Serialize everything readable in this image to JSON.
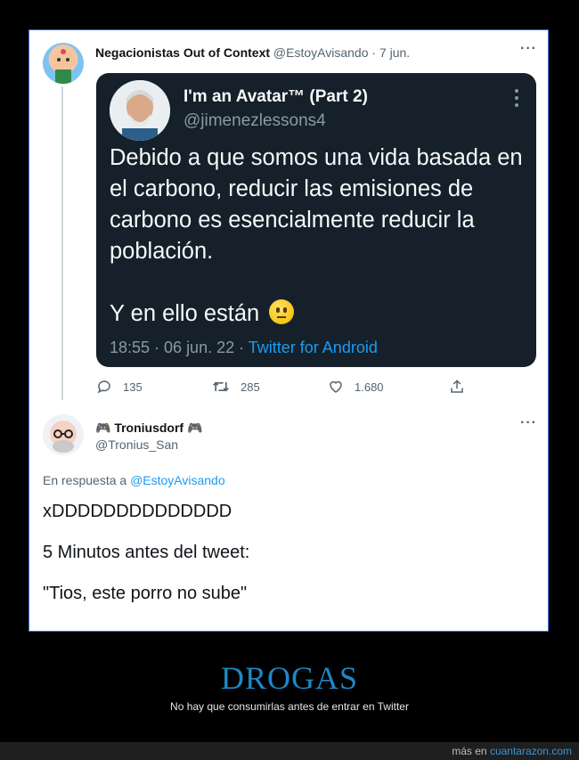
{
  "tweet1": {
    "display_name": "Negacionistas Out of Context",
    "handle": "@EstoyAvisando",
    "separator": "·",
    "date": "7 jun.",
    "more_icon": "more-icon"
  },
  "quoted": {
    "display_name": "I'm an Avatar™ (Part 2)",
    "handle": "@jimenezlessons4",
    "body_para1": "Debido a que somos una vida basada en el carbono, reducir las emisiones de carbono es esencialmente reducir la población.",
    "body_para2": "Y en ello están",
    "emoji": "neutral-face-emoji",
    "time": "18:55 · 06 jun. 22 · ",
    "source": "Twitter for Android"
  },
  "actions": {
    "replies": "135",
    "retweets": "285",
    "likes": "1.680"
  },
  "tweet2": {
    "display_name": "🎮 Troniusdorf 🎮",
    "handle": "@Tronius_San",
    "reply_prefix": "En respuesta a ",
    "reply_handle": "@EstoyAvisando",
    "lines": [
      "xDDDDDDDDDDDDDD",
      "5 Minutos antes del tweet:",
      "\"Tios, este porro no sube\""
    ]
  },
  "caption": {
    "title": "DROGAS",
    "subtitle": "No hay que consumirlas antes de entrar en Twitter"
  },
  "footer": {
    "prefix": "más en ",
    "site": "cuantarazon.com"
  },
  "colors": {
    "accent": "#1d9bf0",
    "caption_title": "#1e88c7",
    "quoted_bg": "#15202b"
  }
}
